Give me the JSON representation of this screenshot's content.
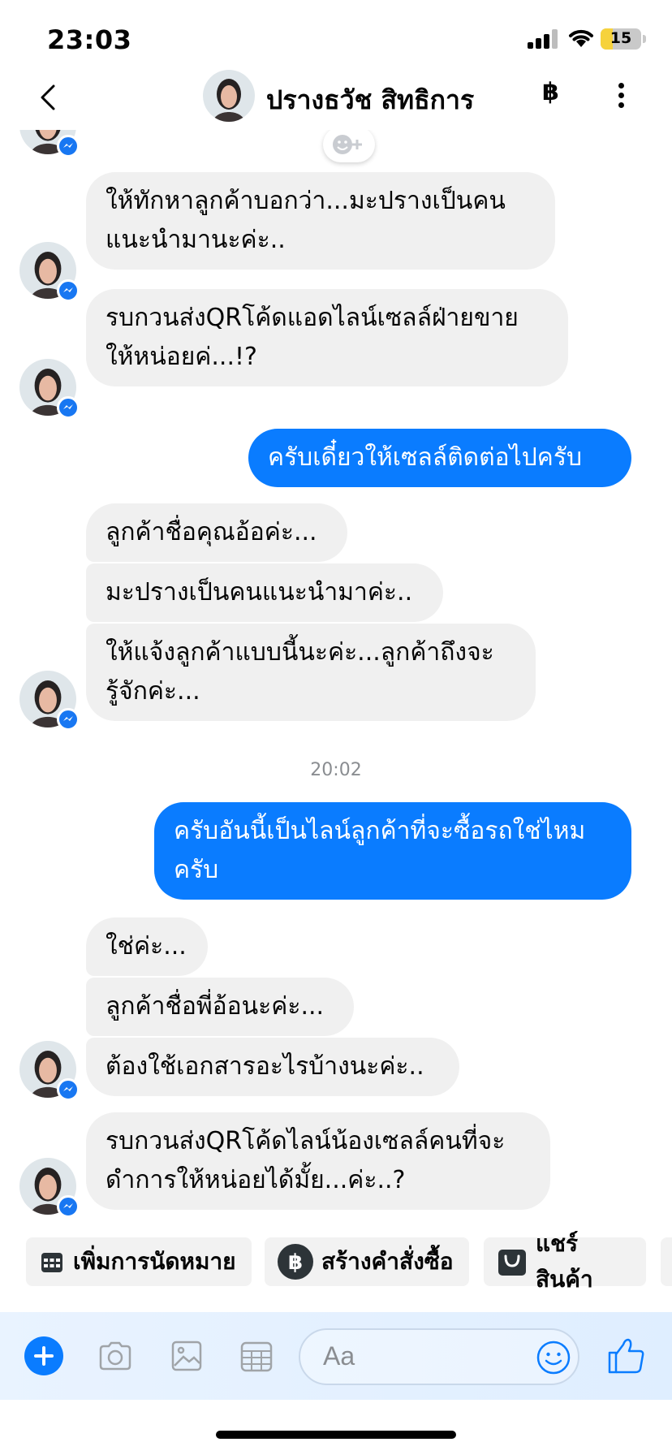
{
  "status_bar": {
    "time": "23:03",
    "battery": "15"
  },
  "header": {
    "contact_name": "ปรางธวัช สิทธิการ",
    "baht_symbol": "฿"
  },
  "conversation": {
    "messages": [
      {
        "lines": [
          "ให้ทักหาลูกค้าบอกว่า...มะปรางเป็นคน",
          "แนะนำมานะค่ะ.."
        ]
      },
      {
        "lines": [
          "รบกวนส่งQRโค้ดแอดไลน์เซลล์ฝ่ายขาย",
          "ให้หน่อยค่...!?"
        ]
      },
      {
        "lines": [
          "ครับเดี๋ยวให้เซลล์ติดต่อไปครับ"
        ]
      },
      {
        "lines": [
          "ลูกค้าชื่อคุณอ้อค่ะ..."
        ]
      },
      {
        "lines": [
          "มะปรางเป็นคนแนะนำมาค่ะ.."
        ]
      },
      {
        "lines": [
          "ให้แจ้งลูกค้าแบบนี้นะค่ะ...ลูกค้าถึงจะ",
          "รู้จักค่ะ..."
        ]
      },
      {
        "lines": [
          "ครับอันนี้เป็นไลน์ลูกค้าที่จะซื้อรถใช่ไหม",
          "ครับ"
        ]
      },
      {
        "lines": [
          "ใช่ค่ะ..."
        ]
      },
      {
        "lines": [
          "ลูกค้าชื่อพี่อ้อนะค่ะ..."
        ]
      },
      {
        "lines": [
          "ต้องใช้เอกสารอะไรบ้างนะค่ะ.."
        ]
      },
      {
        "lines": [
          "รบกวนส่งQRโค้ดไลน์น้องเซลล์คนที่จะ",
          "ดำการให้หน่อยได้มั้ย...ค่ะ..?"
        ]
      }
    ],
    "timestamp": "20:02"
  },
  "quick_actions": [
    {
      "label": "เพิ่มการนัดหมาย",
      "icon": "calendar-icon"
    },
    {
      "label": "สร้างคำสั่งซื้อ",
      "icon": "baht-icon"
    },
    {
      "label": "แชร์สินค้า",
      "icon": "shopping-bag-icon"
    }
  ],
  "composer": {
    "placeholder": "Aa"
  },
  "colors": {
    "accent": "#0a7cff",
    "incoming_bubble": "#f0f0f0",
    "messenger_badge": "#1877f2"
  }
}
